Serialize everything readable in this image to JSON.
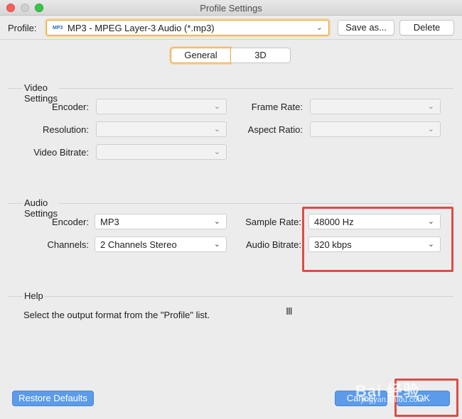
{
  "window": {
    "title": "Profile Settings"
  },
  "toolbar": {
    "profile_label": "Profile:",
    "profile_icon_text": "MP3",
    "profile_value": "MP3 - MPEG Layer-3 Audio (*.mp3)",
    "save_as_label": "Save as...",
    "delete_label": "Delete"
  },
  "tabs": [
    {
      "label": "General",
      "selected": true
    },
    {
      "label": "3D",
      "selected": false
    }
  ],
  "video": {
    "heading": "Video Settings",
    "encoder_label": "Encoder:",
    "encoder_value": "",
    "frame_rate_label": "Frame Rate:",
    "frame_rate_value": "",
    "resolution_label": "Resolution:",
    "resolution_value": "",
    "aspect_ratio_label": "Aspect Ratio:",
    "aspect_ratio_value": "",
    "bitrate_label": "Video Bitrate:",
    "bitrate_value": ""
  },
  "audio": {
    "heading": "Audio Settings",
    "encoder_label": "Encoder:",
    "encoder_value": "MP3",
    "channels_label": "Channels:",
    "channels_value": "2 Channels Stereo",
    "sample_rate_label": "Sample Rate:",
    "sample_rate_value": "48000 Hz",
    "bitrate_label": "Audio Bitrate:",
    "bitrate_value": "320 kbps"
  },
  "help": {
    "heading": "Help",
    "text": "Select the output format from the \"Profile\" list."
  },
  "footer": {
    "restore_label": "Restore Defaults",
    "cancel_label": "Cancel",
    "ok_label": "OK"
  },
  "watermark": {
    "main": "Bai 经验",
    "sub": "jingyan.baidu.com"
  },
  "colors": {
    "accent": "#5b9bea",
    "focus": "#e4a33b",
    "annotation": "#e04b45"
  },
  "icons": {
    "dropdown": "chevron-down-icon",
    "text_cursor": "ibeam-cursor-icon"
  }
}
